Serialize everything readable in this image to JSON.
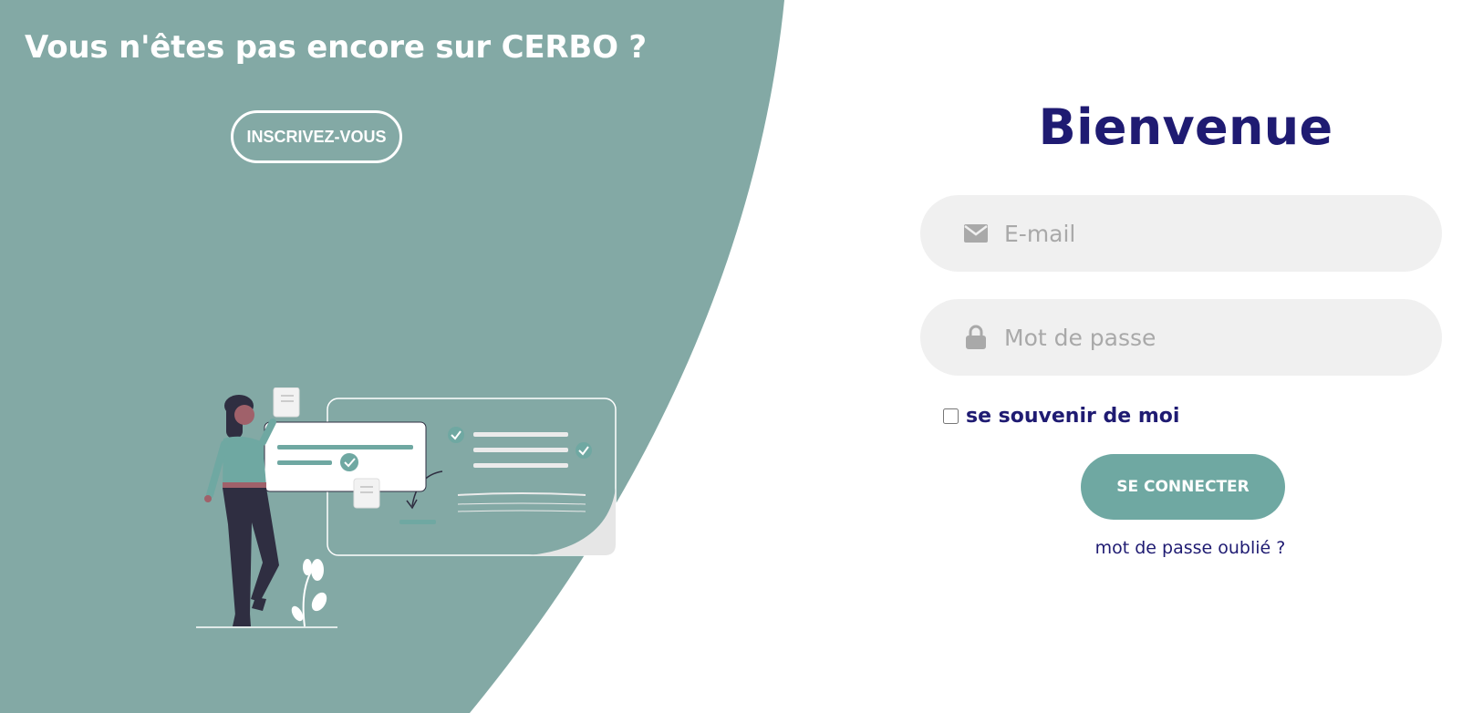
{
  "signup": {
    "title": "Vous n'êtes pas encore sur CERBO ?",
    "button_label": "INSCRIVEZ-VOUS"
  },
  "login": {
    "title": "Bienvenue",
    "email_placeholder": "E-mail",
    "email_icon": "envelope-icon",
    "password_placeholder": "Mot de passe",
    "password_icon": "lock-icon",
    "remember_label": "se souvenir de moi",
    "submit_label": "SE CONNECTER",
    "forgot_label": "mot de passe oublié ?"
  },
  "colors": {
    "panel": "#83a9a5",
    "accent": "#6fa8a2",
    "title": "#1f1b72",
    "input_bg": "#f0f0f0",
    "placeholder": "#a9a9a9"
  }
}
